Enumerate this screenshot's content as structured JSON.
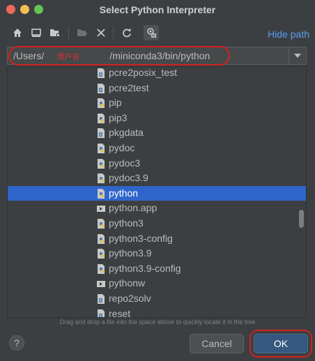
{
  "window": {
    "title": "Select Python Interpreter"
  },
  "toolbar": {
    "hide_path_label": "Hide path"
  },
  "path": {
    "prefix": "/Users/",
    "redacted_note": "用户名",
    "suffix": "/miniconda3/bin/python"
  },
  "tree": {
    "items": [
      {
        "label": "pcre2posix_test",
        "type": "exec-file",
        "selected": false
      },
      {
        "label": "pcre2test",
        "type": "exec-file",
        "selected": false
      },
      {
        "label": "pip",
        "type": "python-file",
        "selected": false
      },
      {
        "label": "pip3",
        "type": "python-file",
        "selected": false
      },
      {
        "label": "pkgdata",
        "type": "exec-file",
        "selected": false
      },
      {
        "label": "pydoc",
        "type": "python-file",
        "selected": false
      },
      {
        "label": "pydoc3",
        "type": "python-file",
        "selected": false
      },
      {
        "label": "pydoc3.9",
        "type": "python-file",
        "selected": false
      },
      {
        "label": "python",
        "type": "python-file",
        "selected": true
      },
      {
        "label": "python.app",
        "type": "folder",
        "selected": false
      },
      {
        "label": "python3",
        "type": "python-file",
        "selected": false
      },
      {
        "label": "python3-config",
        "type": "python-file",
        "selected": false
      },
      {
        "label": "python3.9",
        "type": "python-file",
        "selected": false
      },
      {
        "label": "python3.9-config",
        "type": "python-file",
        "selected": false
      },
      {
        "label": "pythonw",
        "type": "folder",
        "selected": false
      },
      {
        "label": "repo2solv",
        "type": "exec-file",
        "selected": false
      },
      {
        "label": "reset",
        "type": "exec-file",
        "selected": false
      }
    ]
  },
  "hint": "Drag and drop a file into the space above to quickly locate it in the tree",
  "buttons": {
    "help": "?",
    "cancel": "Cancel",
    "ok": "OK"
  },
  "colors": {
    "selection": "#2f65ca",
    "accent_link": "#589df6",
    "annotation": "#d42020"
  }
}
